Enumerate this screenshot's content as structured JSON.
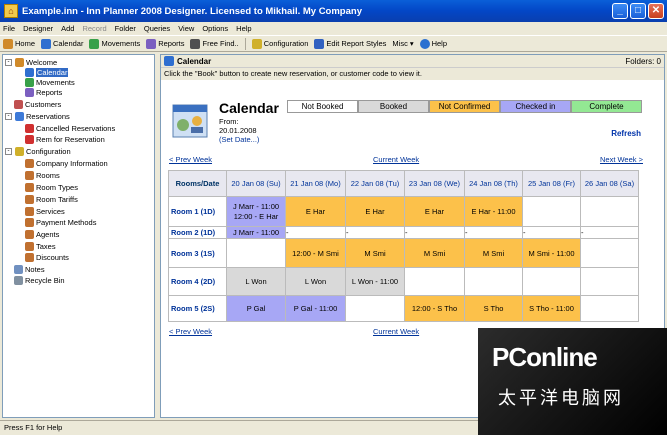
{
  "window": {
    "title": "Example.inn - Inn Planner 2008 Designer. Licensed to Mikhail. My Company",
    "minimize": "_",
    "maximize": "□",
    "close": "✕"
  },
  "menu": [
    "File",
    "Designer",
    "Add",
    "Record",
    "Folder",
    "Queries",
    "View",
    "Options",
    "Help"
  ],
  "toolbar": [
    {
      "label": "Home",
      "color": "#d08a2a"
    },
    {
      "label": "Calendar",
      "color": "#2f6fd0"
    },
    {
      "label": "Movements",
      "color": "#38a049"
    },
    {
      "label": "Reports",
      "color": "#7b5fc0"
    },
    {
      "label": "Free Find..",
      "color": "#505050"
    },
    {
      "label": "Configuration",
      "color": "#d0b02a"
    },
    {
      "label": "Edit Report Styles",
      "color": "#3060c0"
    },
    {
      "label": "Misc",
      "color": "#808080"
    },
    {
      "label": "Help",
      "color": "#2a70d0"
    }
  ],
  "tree": [
    {
      "label": "Welcome",
      "level": 0,
      "color": "#d08a2a",
      "expander": "-"
    },
    {
      "label": "Calendar",
      "level": 1,
      "color": "#2f6fd0",
      "selected": true
    },
    {
      "label": "Movements",
      "level": 1,
      "color": "#38a049"
    },
    {
      "label": "Reports",
      "level": 1,
      "color": "#7b5fc0"
    },
    {
      "label": "Customers",
      "level": 0,
      "color": "#c05050"
    },
    {
      "label": "Reservations",
      "level": 0,
      "color": "#3d7ad8",
      "expander": "-"
    },
    {
      "label": "Cancelled Reservations",
      "level": 1,
      "color": "#d03030"
    },
    {
      "label": "Rem for Reservation",
      "level": 1,
      "color": "#d03030"
    },
    {
      "label": "Configuration",
      "level": 0,
      "color": "#d0b02a",
      "expander": "-"
    },
    {
      "label": "Company Information",
      "level": 1,
      "color": "#c07030"
    },
    {
      "label": "Rooms",
      "level": 1,
      "color": "#c07030"
    },
    {
      "label": "Room Types",
      "level": 1,
      "color": "#c07030"
    },
    {
      "label": "Room Tariffs",
      "level": 1,
      "color": "#c07030"
    },
    {
      "label": "Services",
      "level": 1,
      "color": "#c07030"
    },
    {
      "label": "Payment Methods",
      "level": 1,
      "color": "#c07030"
    },
    {
      "label": "Agents",
      "level": 1,
      "color": "#c07030"
    },
    {
      "label": "Taxes",
      "level": 1,
      "color": "#c07030"
    },
    {
      "label": "Discounts",
      "level": 1,
      "color": "#c07030"
    },
    {
      "label": "Notes",
      "level": 0,
      "color": "#7090c0"
    },
    {
      "label": "Recycle Bin",
      "level": 0,
      "color": "#8090a0"
    }
  ],
  "main": {
    "header": "Calendar",
    "folders": "Folders: 0",
    "instruction": "Click the \"Book\" button to create new reservation, or customer code to view it.",
    "title": "Calendar",
    "legend": [
      {
        "label": "Not Booked",
        "color": "#ffffff"
      },
      {
        "label": "Booked",
        "color": "#d9d9d9"
      },
      {
        "label": "Not Confirmed",
        "color": "#fcc14a"
      },
      {
        "label": "Checked in",
        "color": "#a7a7f5"
      },
      {
        "label": "Complete",
        "color": "#93e893"
      }
    ],
    "from_label": "From:",
    "from_date": "20.01.2008",
    "set_date": "(Set Date...)",
    "refresh": "Refresh",
    "prev_week": "< Prev Week",
    "current_week": "Current Week",
    "next_week": "Next Week >",
    "columns": [
      "Rooms/Date",
      "20 Jan 08 (Su)",
      "21 Jan 08 (Mo)",
      "22 Jan 08 (Tu)",
      "23 Jan 08 (We)",
      "24 Jan 08 (Th)",
      "25 Jan 08 (Fr)",
      "26 Jan 08 (Sa)"
    ],
    "rows": [
      {
        "room": "Room 1 (1D)",
        "cells": [
          {
            "t": "J Marr - 11:00\n12:00 - E Har",
            "c": "ci"
          },
          {
            "t": "E Har",
            "c": "bk"
          },
          {
            "t": "E Har",
            "c": "bk"
          },
          {
            "t": "E Har",
            "c": "bk"
          },
          {
            "t": "E Har - 11:00",
            "c": "bk"
          },
          {
            "t": "",
            "c": ""
          },
          {
            "t": "",
            "c": ""
          }
        ]
      },
      {
        "room": "Room 2 (1D)",
        "cells": [
          {
            "t": "J Marr - 11:00",
            "c": "ci"
          },
          {
            "t": "-",
            "c": "l"
          },
          {
            "t": "-",
            "c": "l"
          },
          {
            "t": "-",
            "c": "l"
          },
          {
            "t": "-",
            "c": "l"
          },
          {
            "t": "-",
            "c": "l"
          },
          {
            "t": "-",
            "c": "l"
          }
        ]
      },
      {
        "room": "Room 3 (1S)",
        "cells": [
          {
            "t": "",
            "c": ""
          },
          {
            "t": "12:00 - M Smi",
            "c": "bk"
          },
          {
            "t": "M Smi",
            "c": "bk"
          },
          {
            "t": "M Smi",
            "c": "bk"
          },
          {
            "t": "M Smi",
            "c": "bk"
          },
          {
            "t": "M Smi - 11:00",
            "c": "bk"
          },
          {
            "t": "",
            "c": ""
          }
        ]
      },
      {
        "room": "Room 4 (2D)",
        "cells": [
          {
            "t": "L Won",
            "c": "nb"
          },
          {
            "t": "L Won",
            "c": "nb"
          },
          {
            "t": "L Won - 11:00",
            "c": "nb"
          },
          {
            "t": "",
            "c": ""
          },
          {
            "t": "",
            "c": ""
          },
          {
            "t": "",
            "c": ""
          },
          {
            "t": "",
            "c": ""
          }
        ]
      },
      {
        "room": "Room 5 (2S)",
        "cells": [
          {
            "t": "P Gal",
            "c": "ci"
          },
          {
            "t": "P Gal - 11:00",
            "c": "ci"
          },
          {
            "t": "",
            "c": ""
          },
          {
            "t": "12:00 - S Tho",
            "c": "bk"
          },
          {
            "t": "S Tho",
            "c": "bk"
          },
          {
            "t": "S Tho - 11:00",
            "c": "bk"
          },
          {
            "t": "",
            "c": ""
          }
        ]
      }
    ]
  },
  "status": "Press F1 for Help",
  "watermark": {
    "brand": "PConline",
    "sub": "太平洋电脑网"
  }
}
